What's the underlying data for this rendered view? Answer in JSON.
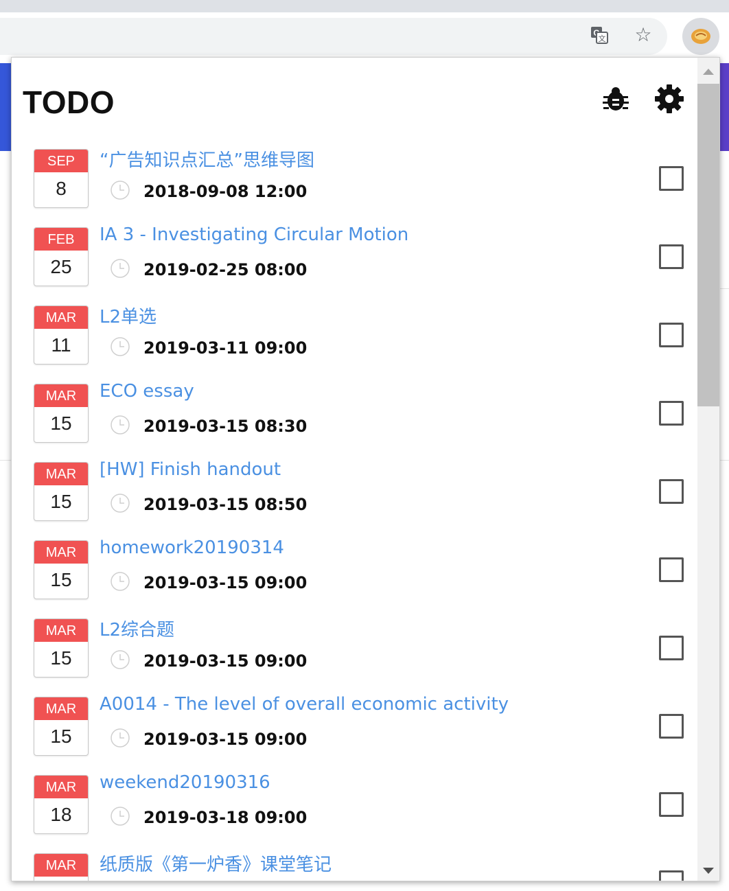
{
  "browser": {
    "icons": [
      "translate-icon",
      "star-icon",
      "extension-icon"
    ]
  },
  "popup": {
    "title": "TODO",
    "header_icons": [
      "bug-icon",
      "gear-icon"
    ],
    "colors": {
      "accent": "#4a90e2",
      "calendar_header": "#f05252"
    }
  },
  "tasks": [
    {
      "month": "SEP",
      "day": "8",
      "title": "“广告知识点汇总”思维导图",
      "due": "2018-09-08 12:00",
      "done": false
    },
    {
      "month": "FEB",
      "day": "25",
      "title": "IA 3 - Investigating Circular Motion",
      "due": "2019-02-25 08:00",
      "done": false
    },
    {
      "month": "MAR",
      "day": "11",
      "title": "L2单选",
      "due": "2019-03-11 09:00",
      "done": false
    },
    {
      "month": "MAR",
      "day": "15",
      "title": "ECO essay",
      "due": "2019-03-15 08:30",
      "done": false
    },
    {
      "month": "MAR",
      "day": "15",
      "title": "[HW] Finish handout",
      "due": "2019-03-15 08:50",
      "done": false
    },
    {
      "month": "MAR",
      "day": "15",
      "title": "homework20190314",
      "due": "2019-03-15 09:00",
      "done": false
    },
    {
      "month": "MAR",
      "day": "15",
      "title": "L2综合题",
      "due": "2019-03-15 09:00",
      "done": false
    },
    {
      "month": "MAR",
      "day": "15",
      "title": "A0014 - The level of overall economic activity",
      "due": "2019-03-15 09:00",
      "done": false
    },
    {
      "month": "MAR",
      "day": "18",
      "title": "weekend20190316",
      "due": "2019-03-18 09:00",
      "done": false
    },
    {
      "month": "MAR",
      "day": "",
      "title": "纸质版《第一炉香》课堂笔记",
      "due": "",
      "done": false
    }
  ]
}
